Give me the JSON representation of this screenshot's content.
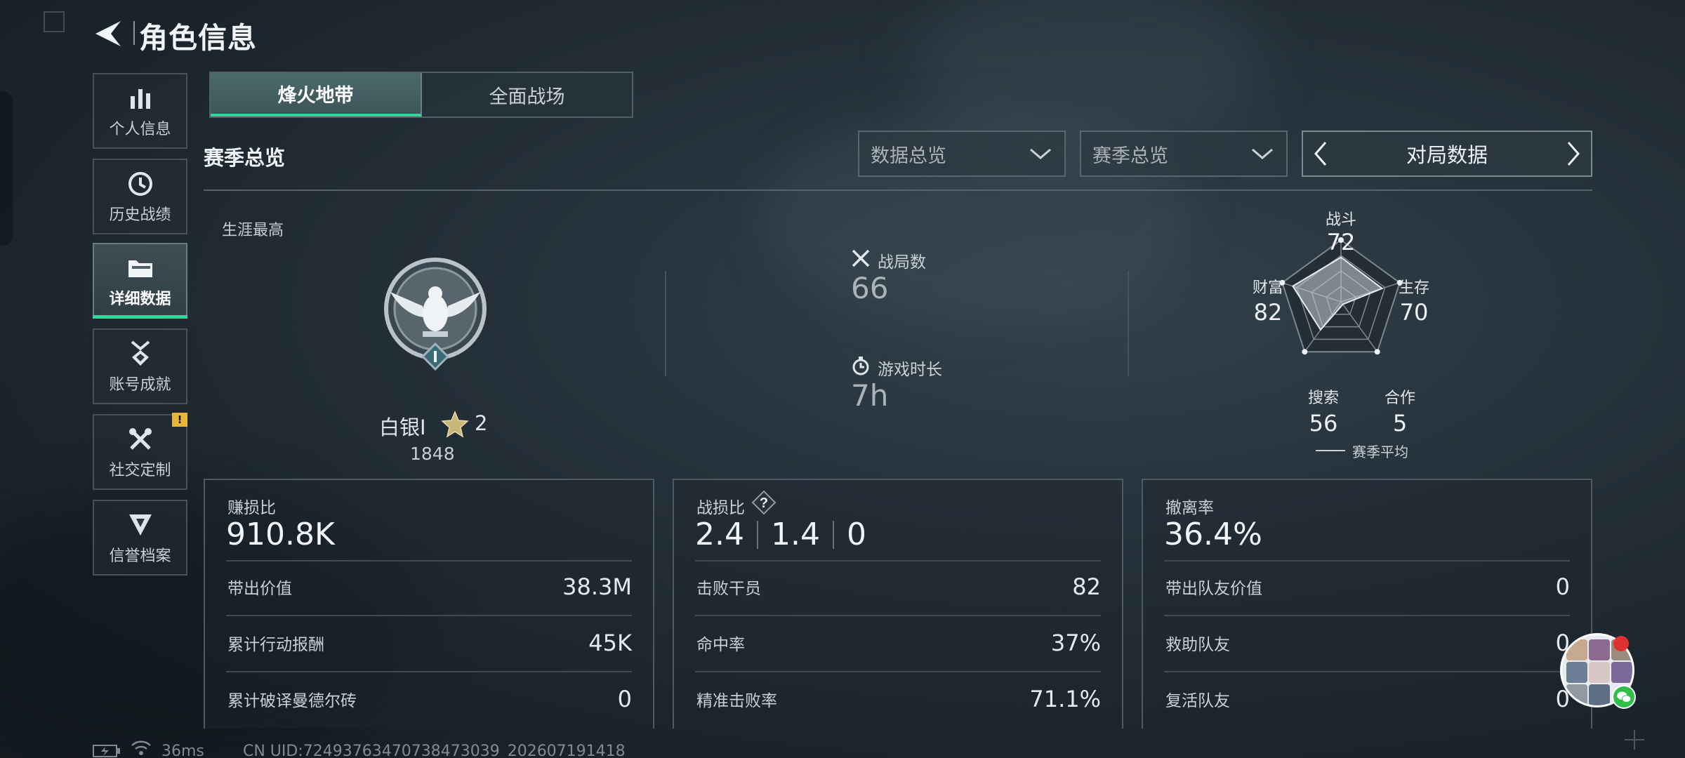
{
  "header": {
    "title": "角色信息"
  },
  "sidebar": {
    "items": [
      {
        "label": "个人信息",
        "icon": "bar-chart-icon"
      },
      {
        "label": "历史战绩",
        "icon": "clock-icon"
      },
      {
        "label": "详细数据",
        "icon": "folder-icon",
        "active": true
      },
      {
        "label": "账号成就",
        "icon": "medal-icon"
      },
      {
        "label": "社交定制",
        "icon": "tools-icon",
        "badge": "!"
      },
      {
        "label": "信誉档案",
        "icon": "shield-icon"
      }
    ]
  },
  "tabs": [
    {
      "label": "烽火地带",
      "active": true
    },
    {
      "label": "全面战场",
      "active": false
    }
  ],
  "section_title": "赛季总览",
  "filters": {
    "dropdown1": "数据总览",
    "dropdown2": "赛季总览",
    "switcher": "对局数据"
  },
  "career": {
    "label": "生涯最高",
    "rank_name": "白银I",
    "stars": "2",
    "score": "1848"
  },
  "stats": {
    "matches_label": "战局数",
    "matches_value": "66",
    "playtime_label": "游戏时长",
    "playtime_value": "7h"
  },
  "radar": {
    "axes": [
      {
        "label": "战斗",
        "value": "72"
      },
      {
        "label": "生存",
        "value": "70"
      },
      {
        "label": "合作",
        "value": "5"
      },
      {
        "label": "搜索",
        "value": "56"
      },
      {
        "label": "财富",
        "value": "82"
      }
    ],
    "legend": "赛季平均"
  },
  "cards": {
    "profit": {
      "label": "赚损比",
      "value": "910.8K",
      "rows": [
        {
          "label": "带出价值",
          "value": "38.3M"
        },
        {
          "label": "累计行动报酬",
          "value": "45K"
        },
        {
          "label": "累计破译曼德尔砖",
          "value": "0"
        }
      ]
    },
    "combat": {
      "label": "战损比",
      "help": "?",
      "kd": [
        "2.4",
        "1.4",
        "0"
      ],
      "rows": [
        {
          "label": "击败干员",
          "value": "82"
        },
        {
          "label": "命中率",
          "value": "37%"
        },
        {
          "label": "精准击败率",
          "value": "71.1%"
        }
      ]
    },
    "extract": {
      "label": "撤离率",
      "value": "36.4%",
      "rows": [
        {
          "label": "带出队友价值",
          "value": "0"
        },
        {
          "label": "救助队友",
          "value": "0"
        },
        {
          "label": "复活队友",
          "value": "0"
        }
      ]
    }
  },
  "footer": {
    "ping": "36ms",
    "uid": "CN UID:72493763470738473039_202607191418"
  },
  "colors": {
    "accent": "#36d39a",
    "badge": "#e8b73a"
  }
}
